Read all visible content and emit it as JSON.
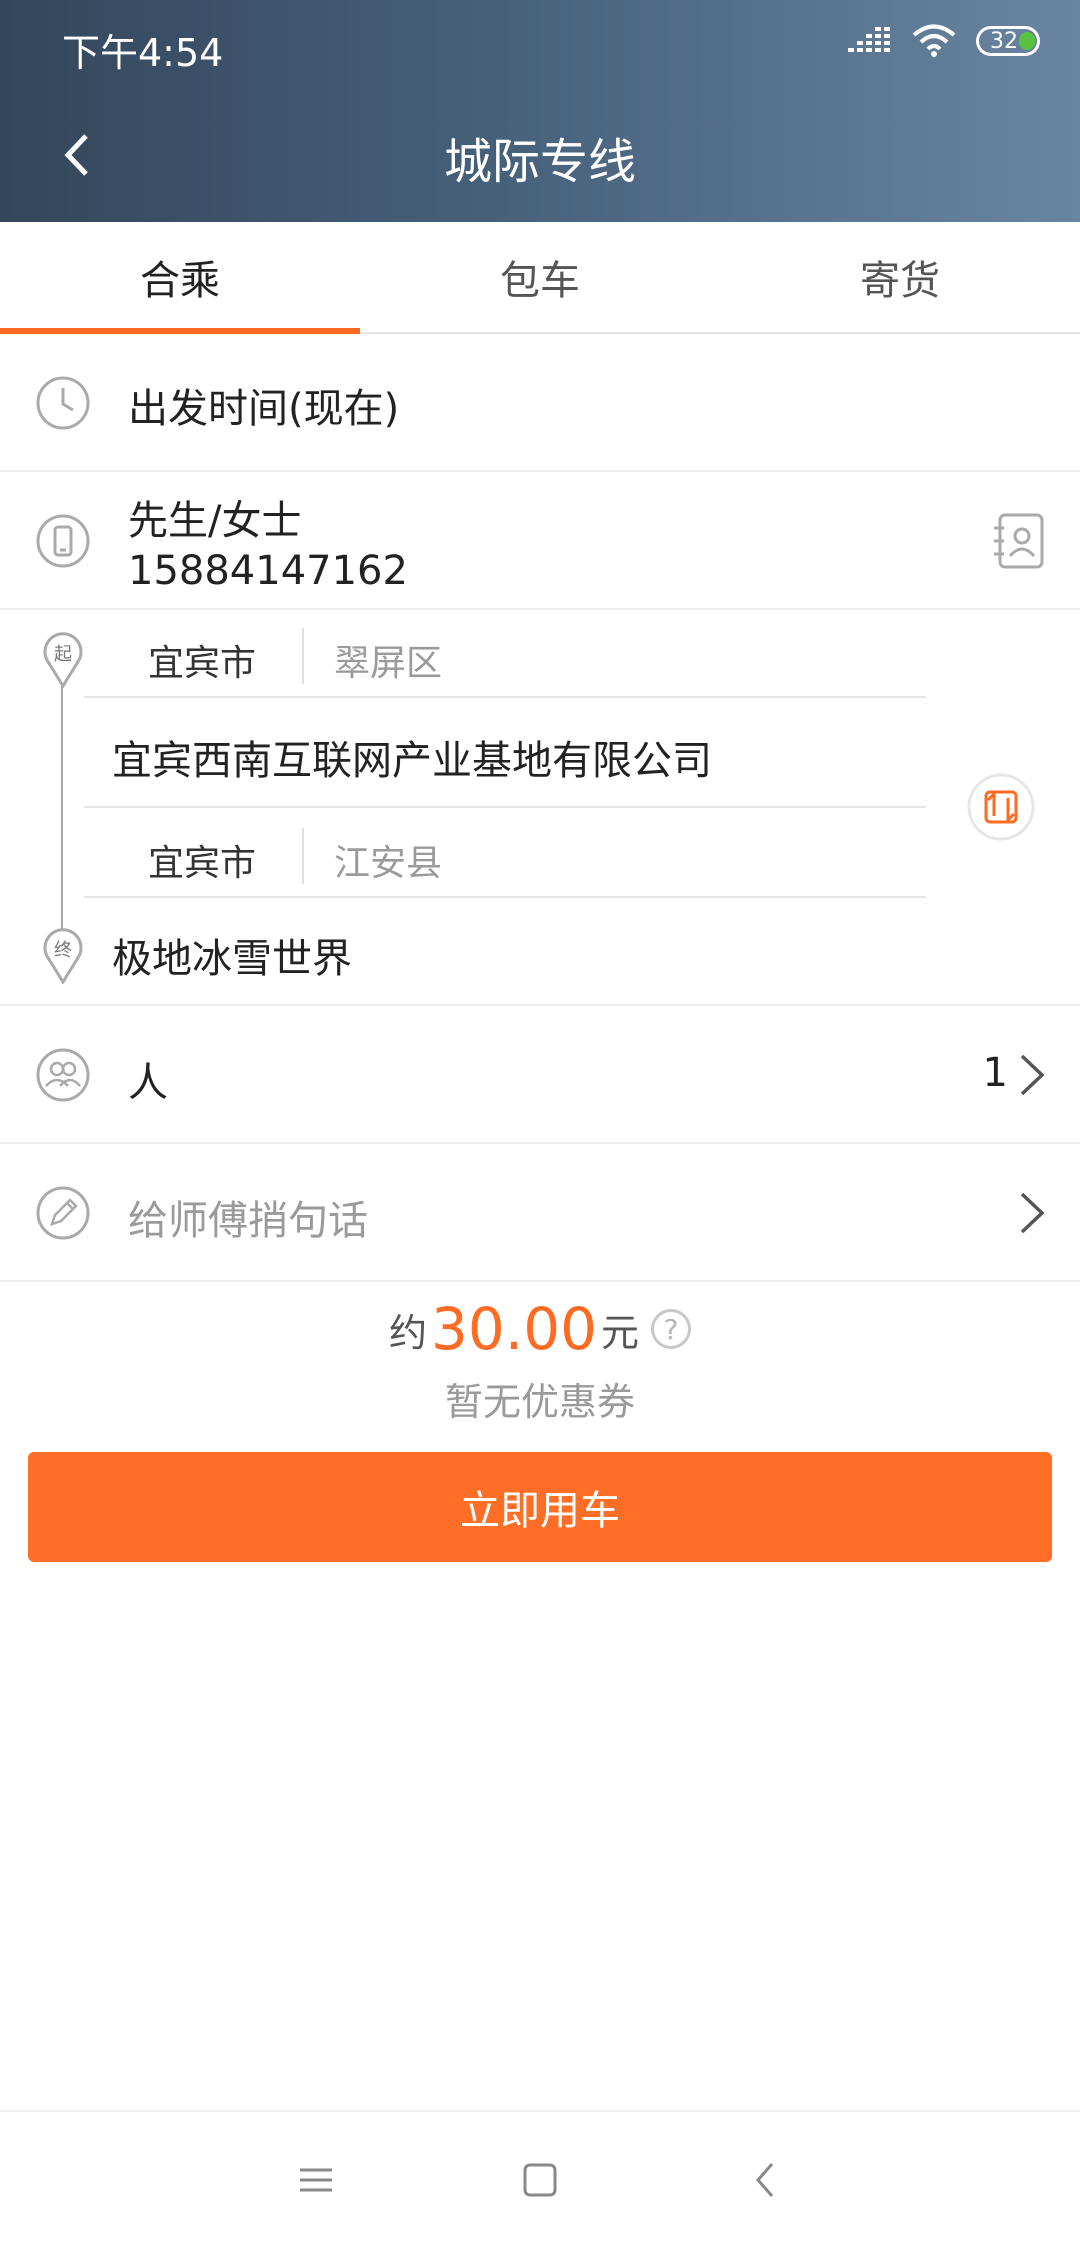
{
  "status_bar": {
    "time": "下午4:54",
    "battery": "32"
  },
  "header": {
    "title": "城际专线"
  },
  "tabs": [
    {
      "label": "合乘",
      "active": true
    },
    {
      "label": "包车",
      "active": false
    },
    {
      "label": "寄货",
      "active": false
    }
  ],
  "departure": {
    "label": "出发时间(现在)"
  },
  "contact": {
    "name": "先生/女士",
    "phone": "15884147162"
  },
  "route": {
    "start_marker": "起",
    "end_marker": "终",
    "start_city": "宜宾市",
    "start_district": "翠屏区",
    "start_address": "宜宾西南互联网产业基地有限公司",
    "end_city": "宜宾市",
    "end_district": "江安县",
    "end_address": "极地冰雪世界"
  },
  "passengers": {
    "label": "人",
    "count": "1"
  },
  "message": {
    "placeholder": "给师傅捎句话"
  },
  "price": {
    "prefix": "约",
    "amount": "30.00",
    "unit": "元",
    "help": "?",
    "coupon": "暂无优惠券"
  },
  "cta": {
    "label": "立即用车"
  },
  "colors": {
    "accent": "#ff6b22",
    "header_start": "#34465b",
    "header_end": "#6a85a1"
  }
}
